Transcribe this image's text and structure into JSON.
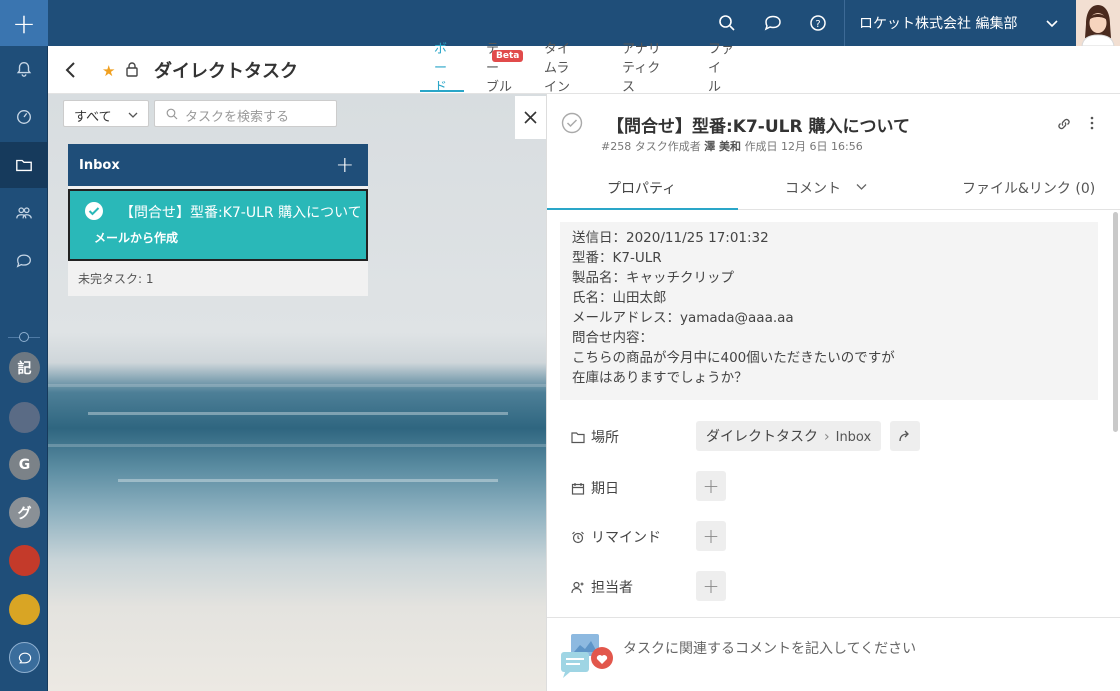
{
  "rail": {
    "add_label": "+",
    "avatars": [
      {
        "label": "記",
        "color": "#6d7882"
      },
      {
        "label": "",
        "color": "#5a6b85"
      },
      {
        "label": "G",
        "color": "#7b8288"
      },
      {
        "label": "グ",
        "color": "#8a9096"
      },
      {
        "label": "",
        "color": "#c43a2a"
      },
      {
        "label": "",
        "color": "#d9a524"
      }
    ]
  },
  "topbar": {
    "org_name": "ロケット株式会社 編集部"
  },
  "header": {
    "title": "ダイレクトタスク",
    "tabs": [
      {
        "label": "ボ\nー\nド",
        "active": true
      },
      {
        "label": "テ\nー\nブル",
        "active": false
      },
      {
        "label": "タイ\nムラ\nイン",
        "active": false
      },
      {
        "label": "アナリ\nティク\nス",
        "active": false
      },
      {
        "label": "ファ\nイ\nル",
        "active": false
      }
    ],
    "beta_badge": "Beta"
  },
  "filter": {
    "selected": "すべて",
    "search_placeholder": "タスクを検索する"
  },
  "column": {
    "name": "Inbox",
    "add_label": "+",
    "footer": "未完タスク: 1"
  },
  "card": {
    "title": "【問合せ】型番:K7-ULR 購入について",
    "subtitle": "メールから作成"
  },
  "panel": {
    "title": "【問合せ】型番:K7-ULR 購入について",
    "meta_prefix": "#258 タスク作成者",
    "meta_author": "澤 美和",
    "meta_created": "作成日 12月 6日 16:56",
    "tabs": {
      "properties": "プロパティ",
      "comments": "コメント",
      "files": "ファイル&リンク (0)"
    },
    "description": [
      "送信日：2020/11/25 17:01:32",
      "型番：K7-ULR",
      "製品名：キャッチクリップ",
      "氏名：山田太郎",
      "メールアドレス：yamada@aaa.aa",
      "問合せ内容：",
      "こちらの商品が今月中に400個いただきたいのですが",
      "在庫はありますでしょうか？"
    ],
    "props": {
      "location_label": "場所",
      "location_value": "ダイレクトタスク",
      "location_sub": "Inbox",
      "due_label": "期日",
      "reminder_label": "リマインド",
      "assignee_label": "担当者"
    },
    "comment_placeholder": "タスクに関連するコメントを記入してください"
  }
}
